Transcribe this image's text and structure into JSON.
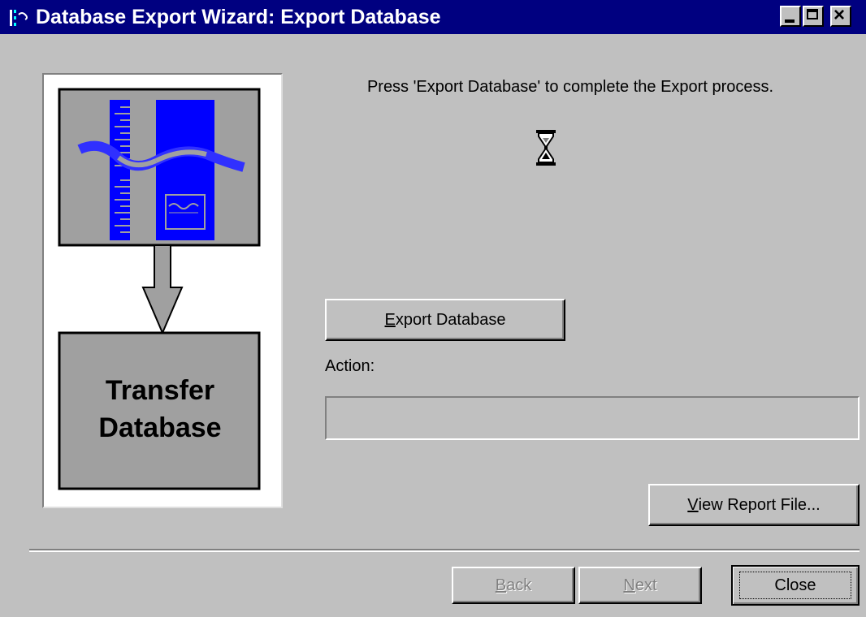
{
  "window": {
    "title": "Database Export Wizard: Export Database",
    "controls": [
      "minimize-icon",
      "maximize-icon",
      "close-icon"
    ]
  },
  "illustration": {
    "box_text_line1": "Transfer",
    "box_text_line2": "Database",
    "colors": {
      "accent_blue": "#0000ff",
      "wave_blue": "#3030ff",
      "panel_gray": "#a0a0a0"
    }
  },
  "main": {
    "instruction": "Press 'Export Database' to complete the Export process.",
    "status_icon": "hourglass-icon",
    "export_button": {
      "accel": "E",
      "rest": "xport Database"
    },
    "action_label": "Action:",
    "action_value": "",
    "view_report_button": {
      "accel": "V",
      "rest": "iew Report File..."
    }
  },
  "footer": {
    "back_button": {
      "accel": "B",
      "rest": "ack",
      "enabled": false
    },
    "next_button": {
      "accel": "N",
      "rest": "ext",
      "enabled": false
    },
    "close_button": {
      "label": "Close",
      "focused": true
    }
  }
}
